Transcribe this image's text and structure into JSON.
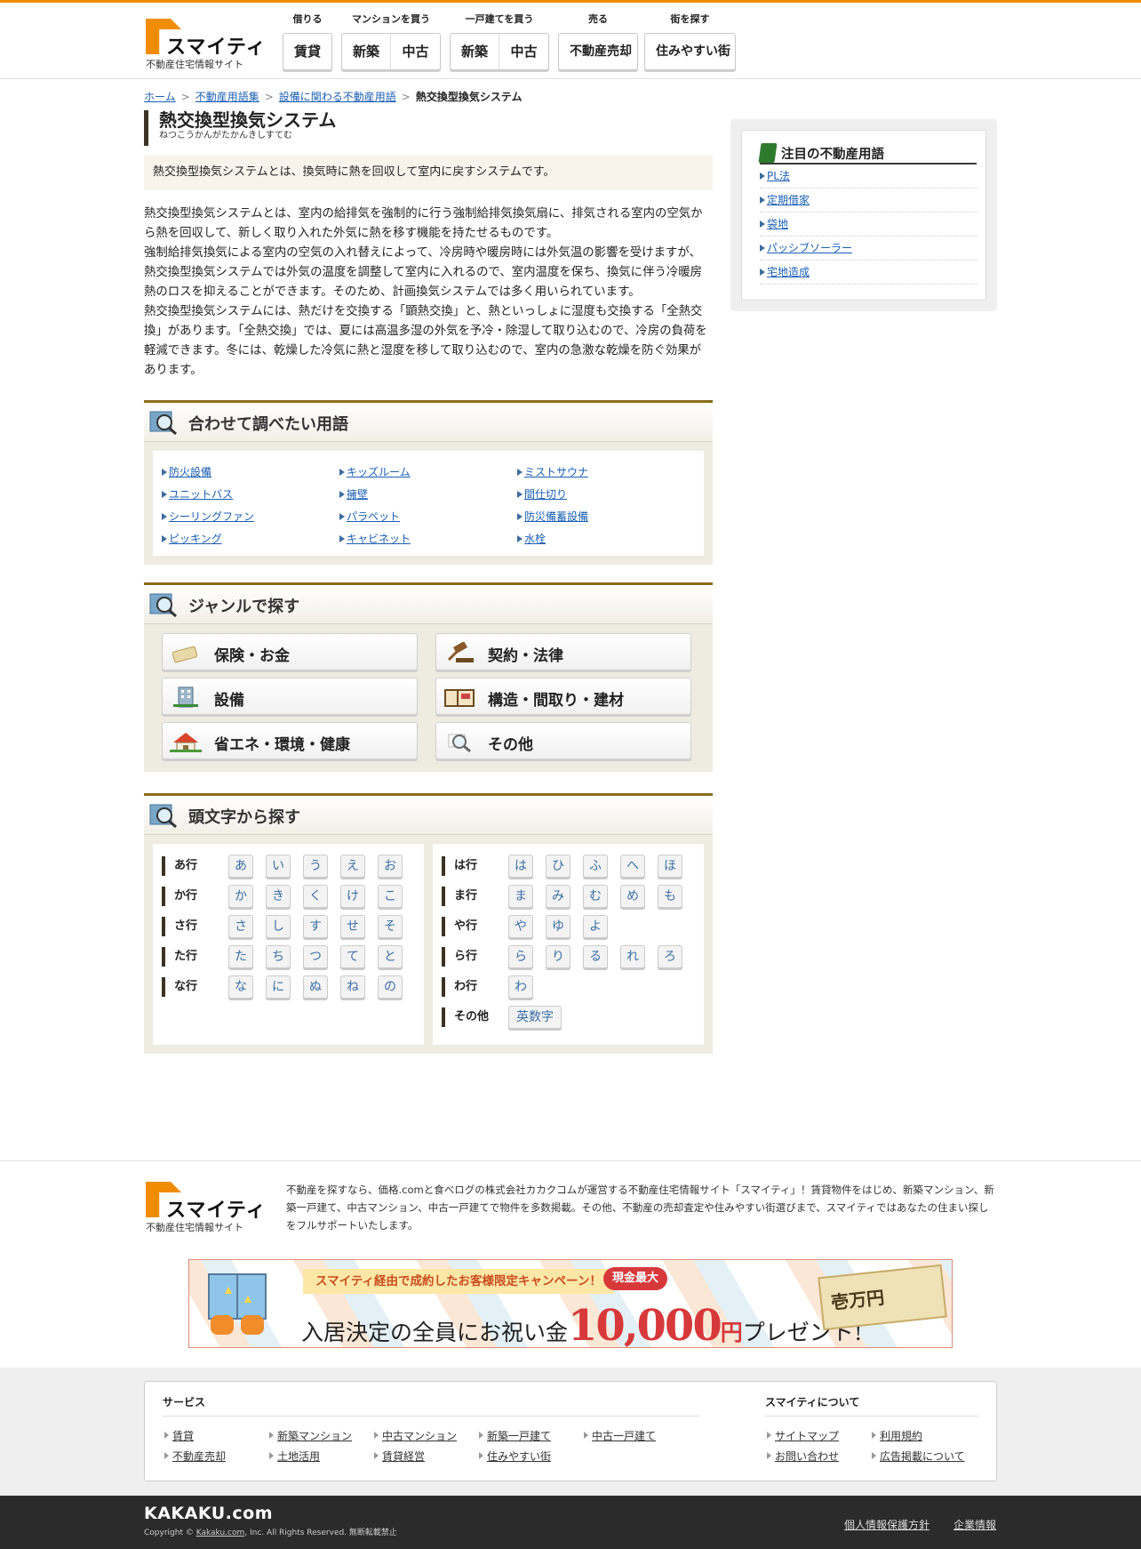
{
  "header": {
    "logo_text": "スマイティ",
    "logo_sub": "不動産住宅情報サイト",
    "nav": [
      {
        "label": "借りる",
        "buttons": [
          "賃貸"
        ]
      },
      {
        "label": "マンションを買う",
        "buttons": [
          "新築",
          "中古"
        ]
      },
      {
        "label": "一戸建てを買う",
        "buttons": [
          "新築",
          "中古"
        ]
      },
      {
        "label": "売る",
        "buttons": [
          "不動産売却"
        ]
      },
      {
        "label": "街を探す",
        "buttons": [
          "住みやすい街"
        ]
      }
    ]
  },
  "breadcrumb": {
    "items": [
      "ホーム",
      "不動産用語集",
      "設備に関わる不動産用語"
    ],
    "current": "熱交換型換気システム",
    "sep": ">"
  },
  "article": {
    "title": "熱交換型換気システム",
    "reading": "ねつこうかんがたかんきしすてむ",
    "summary": "熱交換型換気システムとは、換気時に熱を回収して室内に戻すシステムです。",
    "body": [
      "熱交換型換気システムとは、室内の給排気を強制的に行う強制給排気換気扇に、排気される室内の空気から熱を回収して、新しく取り入れた外気に熱を移す機能を持たせるものです。",
      "強制給排気換気による室内の空気の入れ替えによって、冷房時や暖房時には外気温の影響を受けますが、熱交換型換気システムでは外気の温度を調整して室内に入れるので、室内温度を保ち、換気に伴う冷暖房熱のロスを抑えることができます。そのため、計画換気システムでは多く用いられています。",
      "熱交換型換気システムには、熱だけを交換する「顕熱交換」と、熱といっしょに湿度も交換する「全熱交換」があります。「全熱交換」では、夏には高温多湿の外気を予冷・除湿して取り込むので、冷房の負荷を軽減できます。冬には、乾燥した冷気に熱と湿度を移して取り込むので、室内の急激な乾燥を防ぐ効果があります。"
    ]
  },
  "related": {
    "title": "合わせて調べたい用語",
    "terms": [
      "防火設備",
      "キッズルーム",
      "ミストサウナ",
      "ユニットバス",
      "擁壁",
      "間仕切り",
      "シーリングファン",
      "パラペット",
      "防災備蓄設備",
      "ピッキング",
      "キャビネット",
      "水栓"
    ]
  },
  "genre": {
    "title": "ジャンルで探す",
    "items": [
      {
        "label": "保険・お金",
        "icon": "money-icon"
      },
      {
        "label": "契約・法律",
        "icon": "gavel-icon"
      },
      {
        "label": "設備",
        "icon": "building-icon"
      },
      {
        "label": "構造・間取り・建材",
        "icon": "floorplan-icon"
      },
      {
        "label": "省エネ・環境・健康",
        "icon": "house-icon"
      },
      {
        "label": "その他",
        "icon": "magnifier-icon"
      }
    ]
  },
  "initial": {
    "title": "頭文字から探す",
    "left": [
      {
        "label": "あ行",
        "kana": [
          "あ",
          "い",
          "う",
          "え",
          "お"
        ]
      },
      {
        "label": "か行",
        "kana": [
          "か",
          "き",
          "く",
          "け",
          "こ"
        ]
      },
      {
        "label": "さ行",
        "kana": [
          "さ",
          "し",
          "す",
          "せ",
          "そ"
        ]
      },
      {
        "label": "た行",
        "kana": [
          "た",
          "ち",
          "つ",
          "て",
          "と"
        ]
      },
      {
        "label": "な行",
        "kana": [
          "な",
          "に",
          "ぬ",
          "ね",
          "の"
        ]
      }
    ],
    "right": [
      {
        "label": "は行",
        "kana": [
          "は",
          "ひ",
          "ふ",
          "へ",
          "ほ"
        ]
      },
      {
        "label": "ま行",
        "kana": [
          "ま",
          "み",
          "む",
          "め",
          "も"
        ]
      },
      {
        "label": "や行",
        "kana": [
          "や",
          "ゆ",
          "よ"
        ]
      },
      {
        "label": "ら行",
        "kana": [
          "ら",
          "り",
          "る",
          "れ",
          "ろ"
        ]
      },
      {
        "label": "わ行",
        "kana": [
          "わ"
        ]
      },
      {
        "label": "その他",
        "kana": [
          "英数字"
        ]
      }
    ]
  },
  "sidebar": {
    "title": "注目の不動産用語",
    "items": [
      "PL法",
      "定期借家",
      "袋地",
      "パッシブソーラー",
      "宅地造成"
    ]
  },
  "footer": {
    "logo_text": "スマイティ",
    "logo_sub": "不動産住宅情報サイト",
    "description": "不動産を探すなら、価格.comと食べログの株式会社カカクコムが運営する不動産住宅情報サイト「スマイティ」！賃貸物件をはじめ、新築マンション、新築一戸建て、中古マンション、中古一戸建てで物件を多数掲載。その他、不動産の売却査定や住みやすい街選びまで、スマイティではあなたの住まい探しをフルサポートいたします。",
    "banner": {
      "top": "スマイティ経由で成約したお客様限定キャンペーン！",
      "badge": "現金最大",
      "main_before": "入居決定の全員にお祝い金",
      "amount": "10,000",
      "yen": "円",
      "after": "プレゼント!",
      "bill": "壱万円"
    },
    "services_title": "サービス",
    "services": [
      "賃貸",
      "新築マンション",
      "中古マンション",
      "新築一戸建て",
      "中古一戸建て",
      "不動産売却",
      "土地活用",
      "賃貸経営",
      "住みやすい街"
    ],
    "about_title": "スマイティについて",
    "about": [
      "サイトマップ",
      "利用規約",
      "お問い合わせ",
      "広告掲載について"
    ],
    "kakaku_logo": "KAKAKU.com",
    "copy_prefix": "Copyright ©",
    "copy_link": "Kakaku.com",
    "copy_suffix": ", Inc. All Rights Reserved. 無断転載禁止",
    "legal": [
      "個人情報保護方針",
      "企業情報"
    ]
  }
}
